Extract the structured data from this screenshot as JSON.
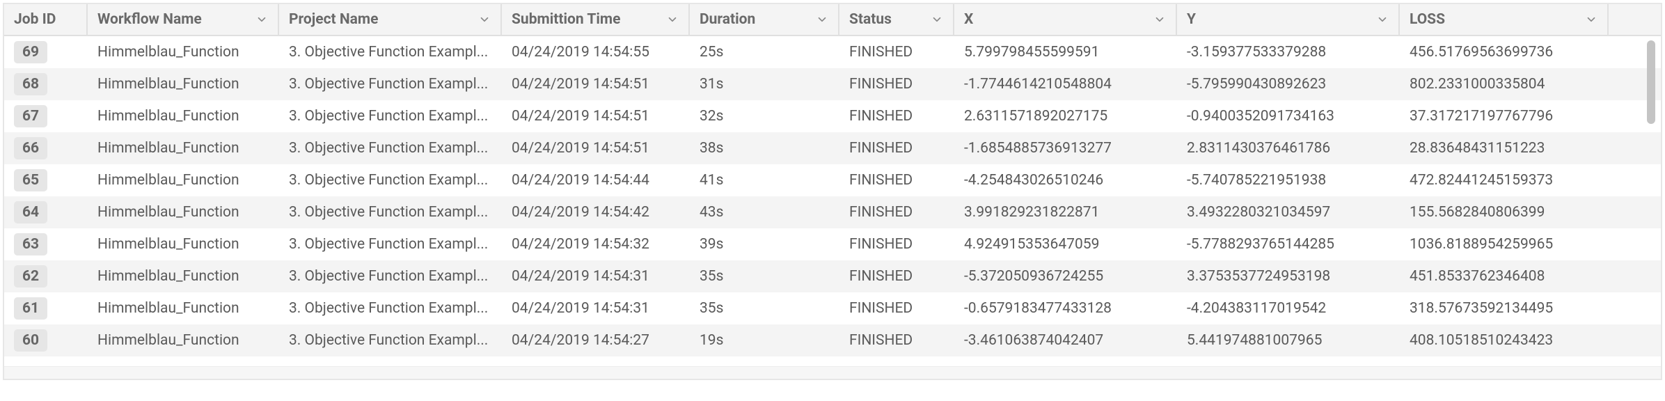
{
  "columns": [
    {
      "key": "job_id",
      "label": "Job ID",
      "hasMenu": false
    },
    {
      "key": "workflow",
      "label": "Workflow Name",
      "hasMenu": true
    },
    {
      "key": "project",
      "label": "Project Name",
      "hasMenu": true
    },
    {
      "key": "submitted",
      "label": "Submittion Time",
      "hasMenu": true
    },
    {
      "key": "duration",
      "label": "Duration",
      "hasMenu": true
    },
    {
      "key": "status",
      "label": "Status",
      "hasMenu": true
    },
    {
      "key": "x",
      "label": "X",
      "hasMenu": true
    },
    {
      "key": "y",
      "label": "Y",
      "hasMenu": true
    },
    {
      "key": "loss",
      "label": "LOSS",
      "hasMenu": true
    }
  ],
  "rows": [
    {
      "job_id": "69",
      "workflow": "Himmelblau_Function",
      "project": "3. Objective Function Exampl...",
      "submitted": "04/24/2019 14:54:55",
      "duration": "25s",
      "status": "FINISHED",
      "x": "5.799798455599591",
      "y": "-3.159377533379288",
      "loss": "456.51769563699736"
    },
    {
      "job_id": "68",
      "workflow": "Himmelblau_Function",
      "project": "3. Objective Function Exampl...",
      "submitted": "04/24/2019 14:54:51",
      "duration": "31s",
      "status": "FINISHED",
      "x": "-1.7744614210548804",
      "y": "-5.795990430892623",
      "loss": "802.2331000335804"
    },
    {
      "job_id": "67",
      "workflow": "Himmelblau_Function",
      "project": "3. Objective Function Exampl...",
      "submitted": "04/24/2019 14:54:51",
      "duration": "32s",
      "status": "FINISHED",
      "x": "2.6311571892027175",
      "y": "-0.9400352091734163",
      "loss": "37.317217197767796"
    },
    {
      "job_id": "66",
      "workflow": "Himmelblau_Function",
      "project": "3. Objective Function Exampl...",
      "submitted": "04/24/2019 14:54:51",
      "duration": "38s",
      "status": "FINISHED",
      "x": "-1.6854885736913277",
      "y": "2.8311430376461786",
      "loss": "28.83648431151223"
    },
    {
      "job_id": "65",
      "workflow": "Himmelblau_Function",
      "project": "3. Objective Function Exampl...",
      "submitted": "04/24/2019 14:54:44",
      "duration": "41s",
      "status": "FINISHED",
      "x": "-4.254843026510246",
      "y": "-5.740785221951938",
      "loss": "472.82441245159373"
    },
    {
      "job_id": "64",
      "workflow": "Himmelblau_Function",
      "project": "3. Objective Function Exampl...",
      "submitted": "04/24/2019 14:54:42",
      "duration": "43s",
      "status": "FINISHED",
      "x": "3.991829231822871",
      "y": "3.4932280321034597",
      "loss": "155.5682840806399"
    },
    {
      "job_id": "63",
      "workflow": "Himmelblau_Function",
      "project": "3. Objective Function Exampl...",
      "submitted": "04/24/2019 14:54:32",
      "duration": "39s",
      "status": "FINISHED",
      "x": "4.924915353647059",
      "y": "-5.7788293765144285",
      "loss": "1036.8188954259965"
    },
    {
      "job_id": "62",
      "workflow": "Himmelblau_Function",
      "project": "3. Objective Function Exampl...",
      "submitted": "04/24/2019 14:54:31",
      "duration": "35s",
      "status": "FINISHED",
      "x": "-5.372050936724255",
      "y": "3.3753537724953198",
      "loss": "451.8533762346408"
    },
    {
      "job_id": "61",
      "workflow": "Himmelblau_Function",
      "project": "3. Objective Function Exampl...",
      "submitted": "04/24/2019 14:54:31",
      "duration": "35s",
      "status": "FINISHED",
      "x": "-0.6579183477433128",
      "y": "-4.204383117019542",
      "loss": "318.57673592134495"
    },
    {
      "job_id": "60",
      "workflow": "Himmelblau_Function",
      "project": "3. Objective Function Exampl...",
      "submitted": "04/24/2019 14:54:27",
      "duration": "19s",
      "status": "FINISHED",
      "x": "-3.461063874042407",
      "y": "5.441974881007965",
      "loss": "408.10518510243423"
    }
  ]
}
